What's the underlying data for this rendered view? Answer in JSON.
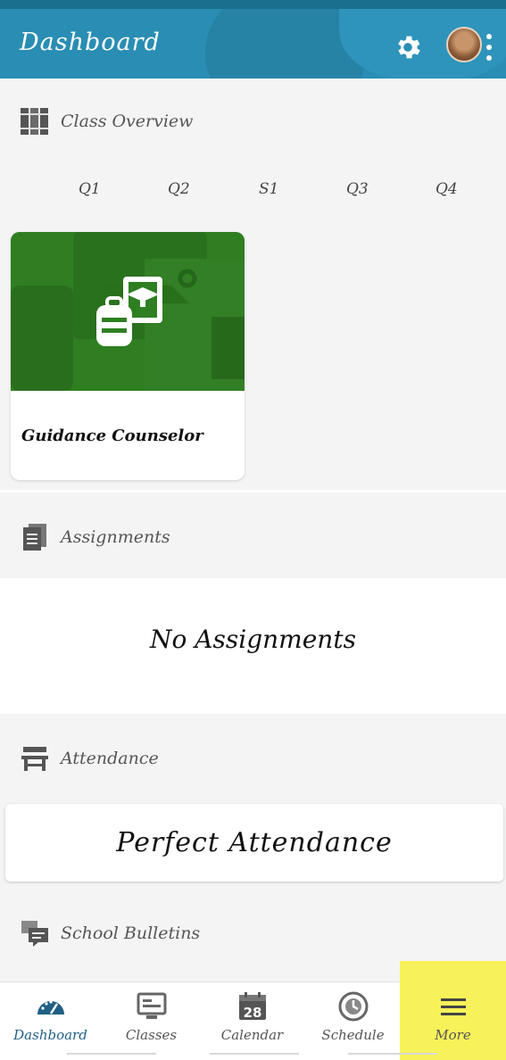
{
  "header": {
    "title": "Dashboard"
  },
  "class_overview": {
    "label": "Class Overview",
    "quarters": [
      "Q1",
      "Q2",
      "S1",
      "Q3",
      "Q4"
    ],
    "cards": [
      {
        "name": "Guidance Counselor"
      }
    ]
  },
  "assignments": {
    "label": "Assignments",
    "empty_text": "No Assignments"
  },
  "attendance": {
    "label": "Attendance",
    "status": "Perfect Attendance"
  },
  "bulletins": {
    "label": "School Bulletins"
  },
  "nav": {
    "items": [
      {
        "label": "Dashboard",
        "icon": "dashboard-gauge-icon",
        "active": true
      },
      {
        "label": "Classes",
        "icon": "classes-monitor-icon"
      },
      {
        "label": "Calendar",
        "icon": "calendar-icon",
        "badge": "28"
      },
      {
        "label": "Schedule",
        "icon": "schedule-clock-icon"
      },
      {
        "label": "More",
        "icon": "menu-lines-icon",
        "highlighted": true
      }
    ]
  },
  "colors": {
    "appbar": "#2a8db3",
    "card_art": "#2f7f22",
    "highlight": "#f7f25a",
    "active_nav": "#1f5f86"
  }
}
